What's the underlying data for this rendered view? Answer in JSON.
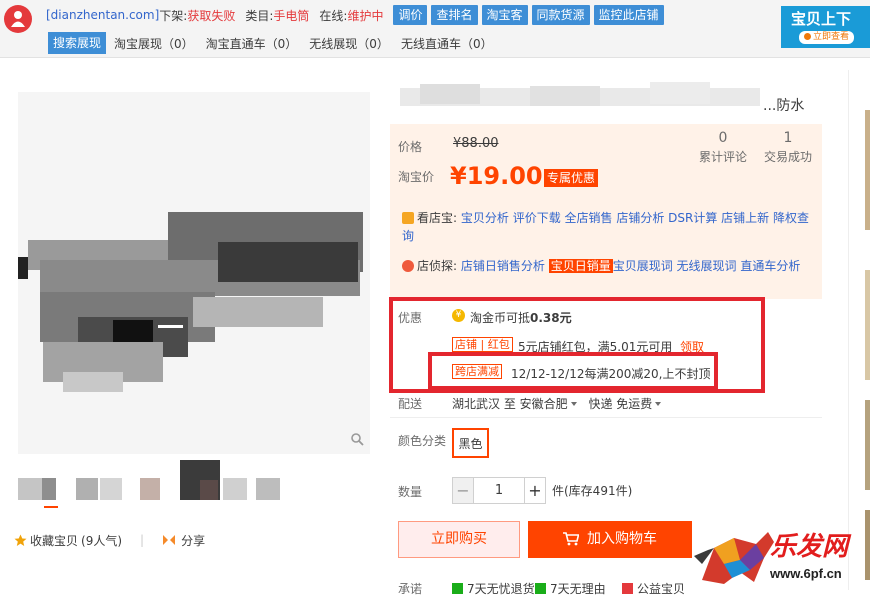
{
  "toolbar": {
    "domain": "[dianzhentan.com]",
    "offshelf_label": "下架:",
    "offshelf_value": "获取失败",
    "category_label": "类目:",
    "category_value": "手电筒",
    "online_label": "在线:",
    "online_value": "维护中",
    "buttons": [
      "调价",
      "查排名",
      "淘宝客",
      "同款货源",
      "监控此店铺"
    ],
    "tabs": [
      "搜索展现",
      "淘宝展现（0）",
      "淘宝直通车（0）",
      "无线展现（0）",
      "无线直通车（0）"
    ],
    "ad_title": "宝贝上下",
    "ad_pill": "立即查看"
  },
  "product": {
    "title_tail": "...防水"
  },
  "price": {
    "orig_label": "价格",
    "orig_value": "¥88.00",
    "curr_label": "淘宝价",
    "curr_value": "¥19.00",
    "badge": "专属优惠",
    "reviews_count": "0",
    "reviews_label": "累计评论",
    "deals_count": "1",
    "deals_label": "交易成功"
  },
  "tools": {
    "kanbao_head": "看店宝:",
    "kanbao_links": "宝贝分析 评价下载 全店销售 店铺分析 DSR计算 店铺上新 降权查询",
    "dianzhen_head": "店侦探:",
    "dianzhen_link1": "店铺日销售分析",
    "dianzhen_highlight": "宝贝日销量",
    "dianzhen_link2": "宝贝展现词 无线展现词 直通车分析"
  },
  "promo": {
    "label": "优惠",
    "coin_icon": "¥",
    "coin_text": "淘金币可抵",
    "coin_value": "0.38元",
    "redpack_tag": "店铺 | 红包",
    "redpack_text": "5元店铺红包，满5.01元可用",
    "redpack_action": "领取",
    "cross_tag": "跨店满减",
    "cross_text": "12/12-12/12每满200减20,上不封顶"
  },
  "delivery": {
    "label": "配送",
    "route": "湖北武汉 至 安徽合肥",
    "fee": "快递 免运费"
  },
  "sku": {
    "color_label": "颜色分类",
    "color_value": "黑色",
    "qty_label": "数量",
    "qty_minus": "−",
    "qty_value": "1",
    "qty_plus": "+",
    "stock": "件(库存491件)"
  },
  "actions": {
    "buy_now": "立即购买",
    "add_cart": "加入购物车"
  },
  "commitments": {
    "label": "承诺",
    "items": [
      "7天无忧退货",
      "7天无理由",
      "公益宝贝"
    ]
  },
  "gallery": {
    "favorite": "收藏宝贝",
    "favorite_count": "(9人气)",
    "share": "分享"
  },
  "watermark": {
    "cn": "乐发网",
    "url": "www.6pf.cn"
  },
  "colors": {
    "accent": "#ff4400",
    "toolbar_blue": "#3e8ed6",
    "highlight_box": "#e3262e"
  }
}
